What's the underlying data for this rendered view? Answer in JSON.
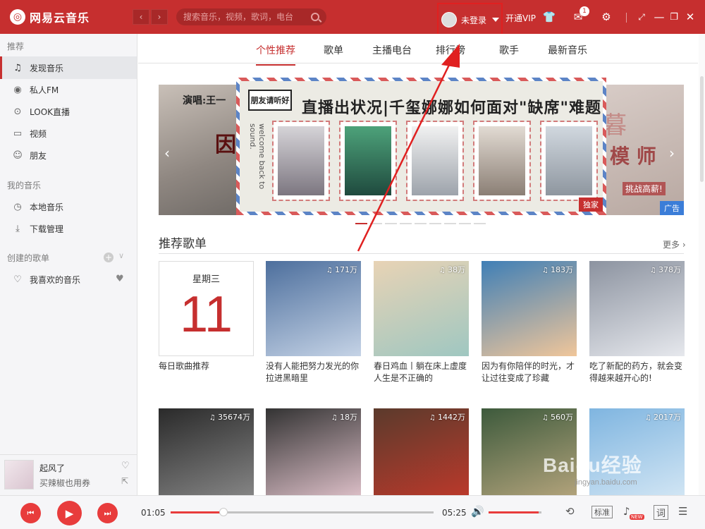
{
  "app": {
    "name": "网易云音乐"
  },
  "search": {
    "placeholder": "搜索音乐，视频，歌词，电台"
  },
  "header": {
    "login_label": "未登录",
    "vip_label": "开通VIP",
    "mail_badge": "1"
  },
  "sidebar": {
    "section_recommend": "推荐",
    "items": [
      {
        "label": "发现音乐",
        "icon": "music-note-icon"
      },
      {
        "label": "私人FM",
        "icon": "radio-icon"
      },
      {
        "label": "LOOK直播",
        "icon": "live-icon"
      },
      {
        "label": "视频",
        "icon": "video-icon"
      },
      {
        "label": "朋友",
        "icon": "friends-icon"
      }
    ],
    "section_my": "我的音乐",
    "my_items": [
      {
        "label": "本地音乐",
        "icon": "local-music-icon"
      },
      {
        "label": "下载管理",
        "icon": "download-icon"
      }
    ],
    "section_created": "创建的歌单",
    "created_items": [
      {
        "label": "我喜欢的音乐",
        "icon": "heart-icon"
      }
    ]
  },
  "now_playing": {
    "title": "起风了",
    "artist": "买辣椒也用券"
  },
  "tabs": [
    "个性推荐",
    "歌单",
    "主播电台",
    "排行榜",
    "歌手",
    "最新音乐"
  ],
  "banner": {
    "left_text": "演唱:王一",
    "left_big": "因",
    "center_tag": "朋友请听好",
    "center_headline": "直播出状况|千玺娜娜如何面对\"缺席\"难题",
    "center_side": "welcome back to sound.",
    "center_badge": "独家",
    "right_text1": "暮",
    "right_text2": "模 师",
    "right_text3": "挑战高薪!",
    "right_badge": "广告"
  },
  "recommend": {
    "title": "推荐歌单",
    "more": "更多",
    "daily": {
      "weekday": "星期三",
      "day": "11",
      "title": "每日歌曲推荐"
    },
    "row1": [
      {
        "count": "171万",
        "title": "没有人能把努力发光的你拉进黑暗里",
        "colors": [
          "#4d6f9d",
          "#c5d3e6"
        ]
      },
      {
        "count": "38万",
        "title": "春日鸡血丨躺在床上虚度人生是不正确的",
        "colors": [
          "#e8d3b5",
          "#9fc7c1"
        ]
      },
      {
        "count": "183万",
        "title": "因为有你陪伴的时光，才让过往变成了珍藏",
        "colors": [
          "#3f7fb6",
          "#f0c69a"
        ]
      },
      {
        "count": "378万",
        "title": "吃了新配的药方，就会变得越来越开心的!",
        "colors": [
          "#8c93a0",
          "#e6e8ed"
        ]
      }
    ],
    "row2": [
      {
        "count": "35674万",
        "colors": [
          "#2a2a2a",
          "#8a8a8a"
        ]
      },
      {
        "count": "18万",
        "colors": [
          "#333",
          "#e5c6cf"
        ]
      },
      {
        "count": "1442万",
        "colors": [
          "#5b3a2c",
          "#c0392b"
        ]
      },
      {
        "count": "560万",
        "colors": [
          "#3d5a3c",
          "#b9a77f"
        ]
      },
      {
        "count": "2017万",
        "colors": [
          "#7fb5e0",
          "#d6e8f5"
        ]
      }
    ]
  },
  "player": {
    "current_time": "01:05",
    "total_time": "05:25",
    "progress": 0.2,
    "volume": 0.95,
    "quality_label": "标准",
    "new_badge": "NEW",
    "lyric_label": "词"
  },
  "watermark": {
    "text": "Baidu经验",
    "sub": "jingyan.baidu.com"
  },
  "colors": {
    "brand": "#c62f2f",
    "annotation": "#e02020"
  }
}
